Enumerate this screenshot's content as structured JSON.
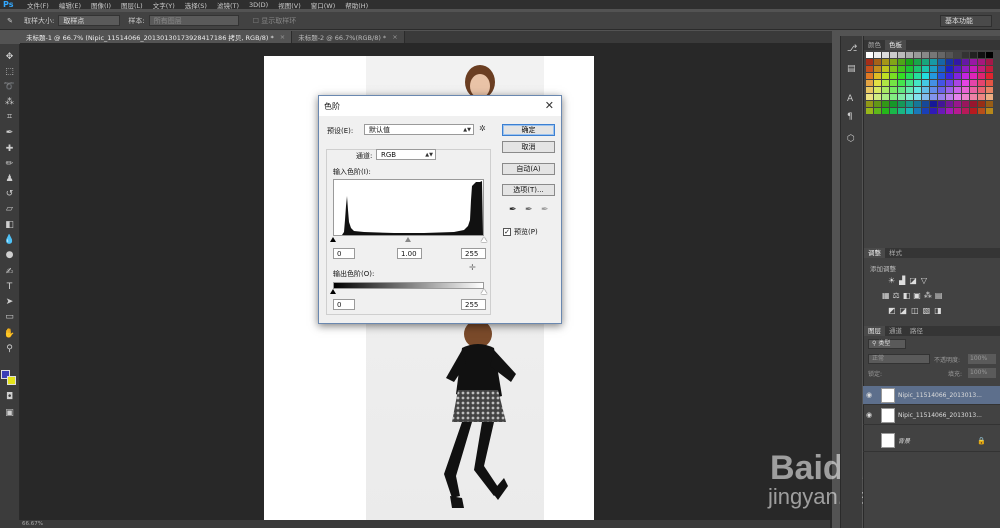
{
  "app": {
    "logo": "Ps",
    "menus": [
      "文件(F)",
      "编辑(E)",
      "图像(I)",
      "图层(L)",
      "文字(Y)",
      "选择(S)",
      "滤镜(T)",
      "3D(D)",
      "视图(V)",
      "窗口(W)",
      "帮助(H)"
    ]
  },
  "options_bar": {
    "sample_size_label": "取样大小:",
    "sample_size_value": "取样点",
    "sample_label": "样本:",
    "sample_value": "所有图层",
    "show_ring_label": "显示取样环",
    "workspace": "基本功能"
  },
  "tabs": [
    {
      "label": "未标题-1 @ 66.7% (Nipic_11514066_20130130173928417186 拷贝, RGB/8) *",
      "close": "×"
    },
    {
      "label": "未标题-2 @ 66.7%(RGB/8) *",
      "close": "×"
    }
  ],
  "panels": {
    "color_tabs": [
      "颜色",
      "色板"
    ],
    "adjust_tabs": [
      "调整",
      "样式"
    ],
    "adjust_hint": "添加调整",
    "layers_tabs": [
      "图层",
      "通道",
      "路径"
    ],
    "kind_label": "类型",
    "blend_mode": "正常",
    "opacity_label": "不透明度:",
    "opacity_value": "100%",
    "lock_label": "锁定:",
    "fill_label": "填充:",
    "fill_value": "100%",
    "layers": [
      {
        "name": "Nipic_11514066_2013013...",
        "selected": true
      },
      {
        "name": "Nipic_11514066_2013013...",
        "selected": false
      },
      {
        "name": "背景",
        "selected": false
      }
    ]
  },
  "dialog": {
    "title": "色阶",
    "close": "✕",
    "preset_label": "预设(E):",
    "preset_value": "默认值",
    "channel_label": "通道:",
    "channel_value": "RGB",
    "input_levels_label": "输入色阶(I):",
    "input_black": "0",
    "input_gamma": "1.00",
    "input_white": "255",
    "output_levels_label": "输出色阶(O):",
    "output_black": "0",
    "output_white": "255",
    "buttons": {
      "ok": "确定",
      "cancel": "取消",
      "auto": "自动(A)",
      "options": "选项(T)..."
    },
    "preview_label": "预览(P)",
    "preview_checked": true
  },
  "watermark": {
    "brand": "Baidu 经验",
    "url": "jingyan.baidu.com"
  },
  "status": {
    "zoom": "66.67%"
  }
}
